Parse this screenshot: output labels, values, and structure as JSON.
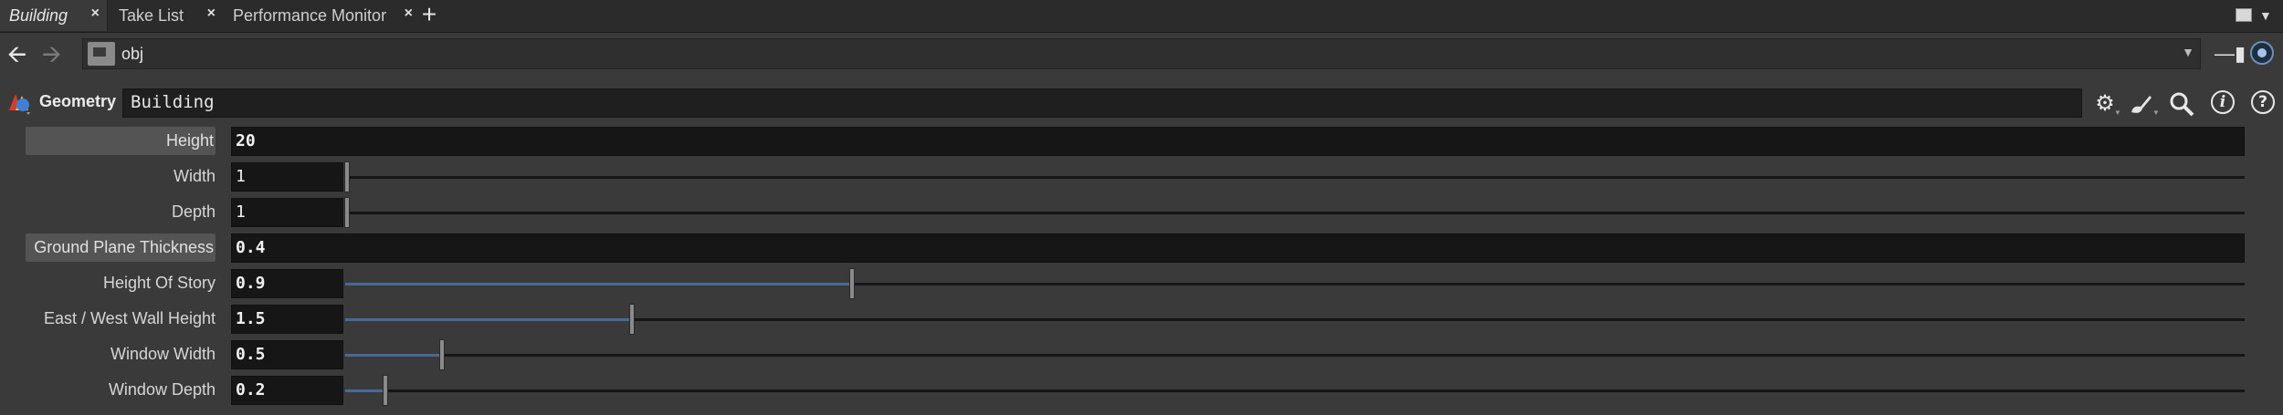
{
  "tabs": [
    {
      "label": "Building",
      "active": true
    },
    {
      "label": "Take List",
      "active": false
    },
    {
      "label": "Performance Monitor",
      "active": false
    }
  ],
  "tab_close_glyph": "×",
  "tab_add_glyph": "+",
  "path": {
    "value": "obj",
    "icon": "network-obj-icon"
  },
  "node": {
    "type_label": "Geometry",
    "name": "Building"
  },
  "header_icons": [
    "gear-icon",
    "paint-brush-icon",
    "search-icon",
    "info-icon",
    "help-icon"
  ],
  "params": [
    {
      "label": "Height",
      "value": "20",
      "kind": "field",
      "label_button": true
    },
    {
      "label": "Width",
      "value": "1",
      "kind": "slider",
      "fraction": 0.0
    },
    {
      "label": "Depth",
      "value": "1",
      "kind": "slider",
      "fraction": 0.0
    },
    {
      "label": "Ground Plane Thickness",
      "value": "0.4",
      "kind": "field",
      "label_button": true
    },
    {
      "label": "Height Of Story",
      "value": "0.9",
      "kind": "slider",
      "fraction": 0.266
    },
    {
      "label": "East / West Wall Height",
      "value": "1.5",
      "kind": "slider",
      "fraction": 0.15
    },
    {
      "label": "Window Width",
      "value": "0.5",
      "kind": "slider",
      "fraction": 0.05
    },
    {
      "label": "Window Depth",
      "value": "0.2",
      "kind": "slider",
      "fraction": 0.02
    }
  ],
  "colors": {
    "slider_fill": "#496a98",
    "background": "#3a3a3a",
    "field": "#161616"
  }
}
